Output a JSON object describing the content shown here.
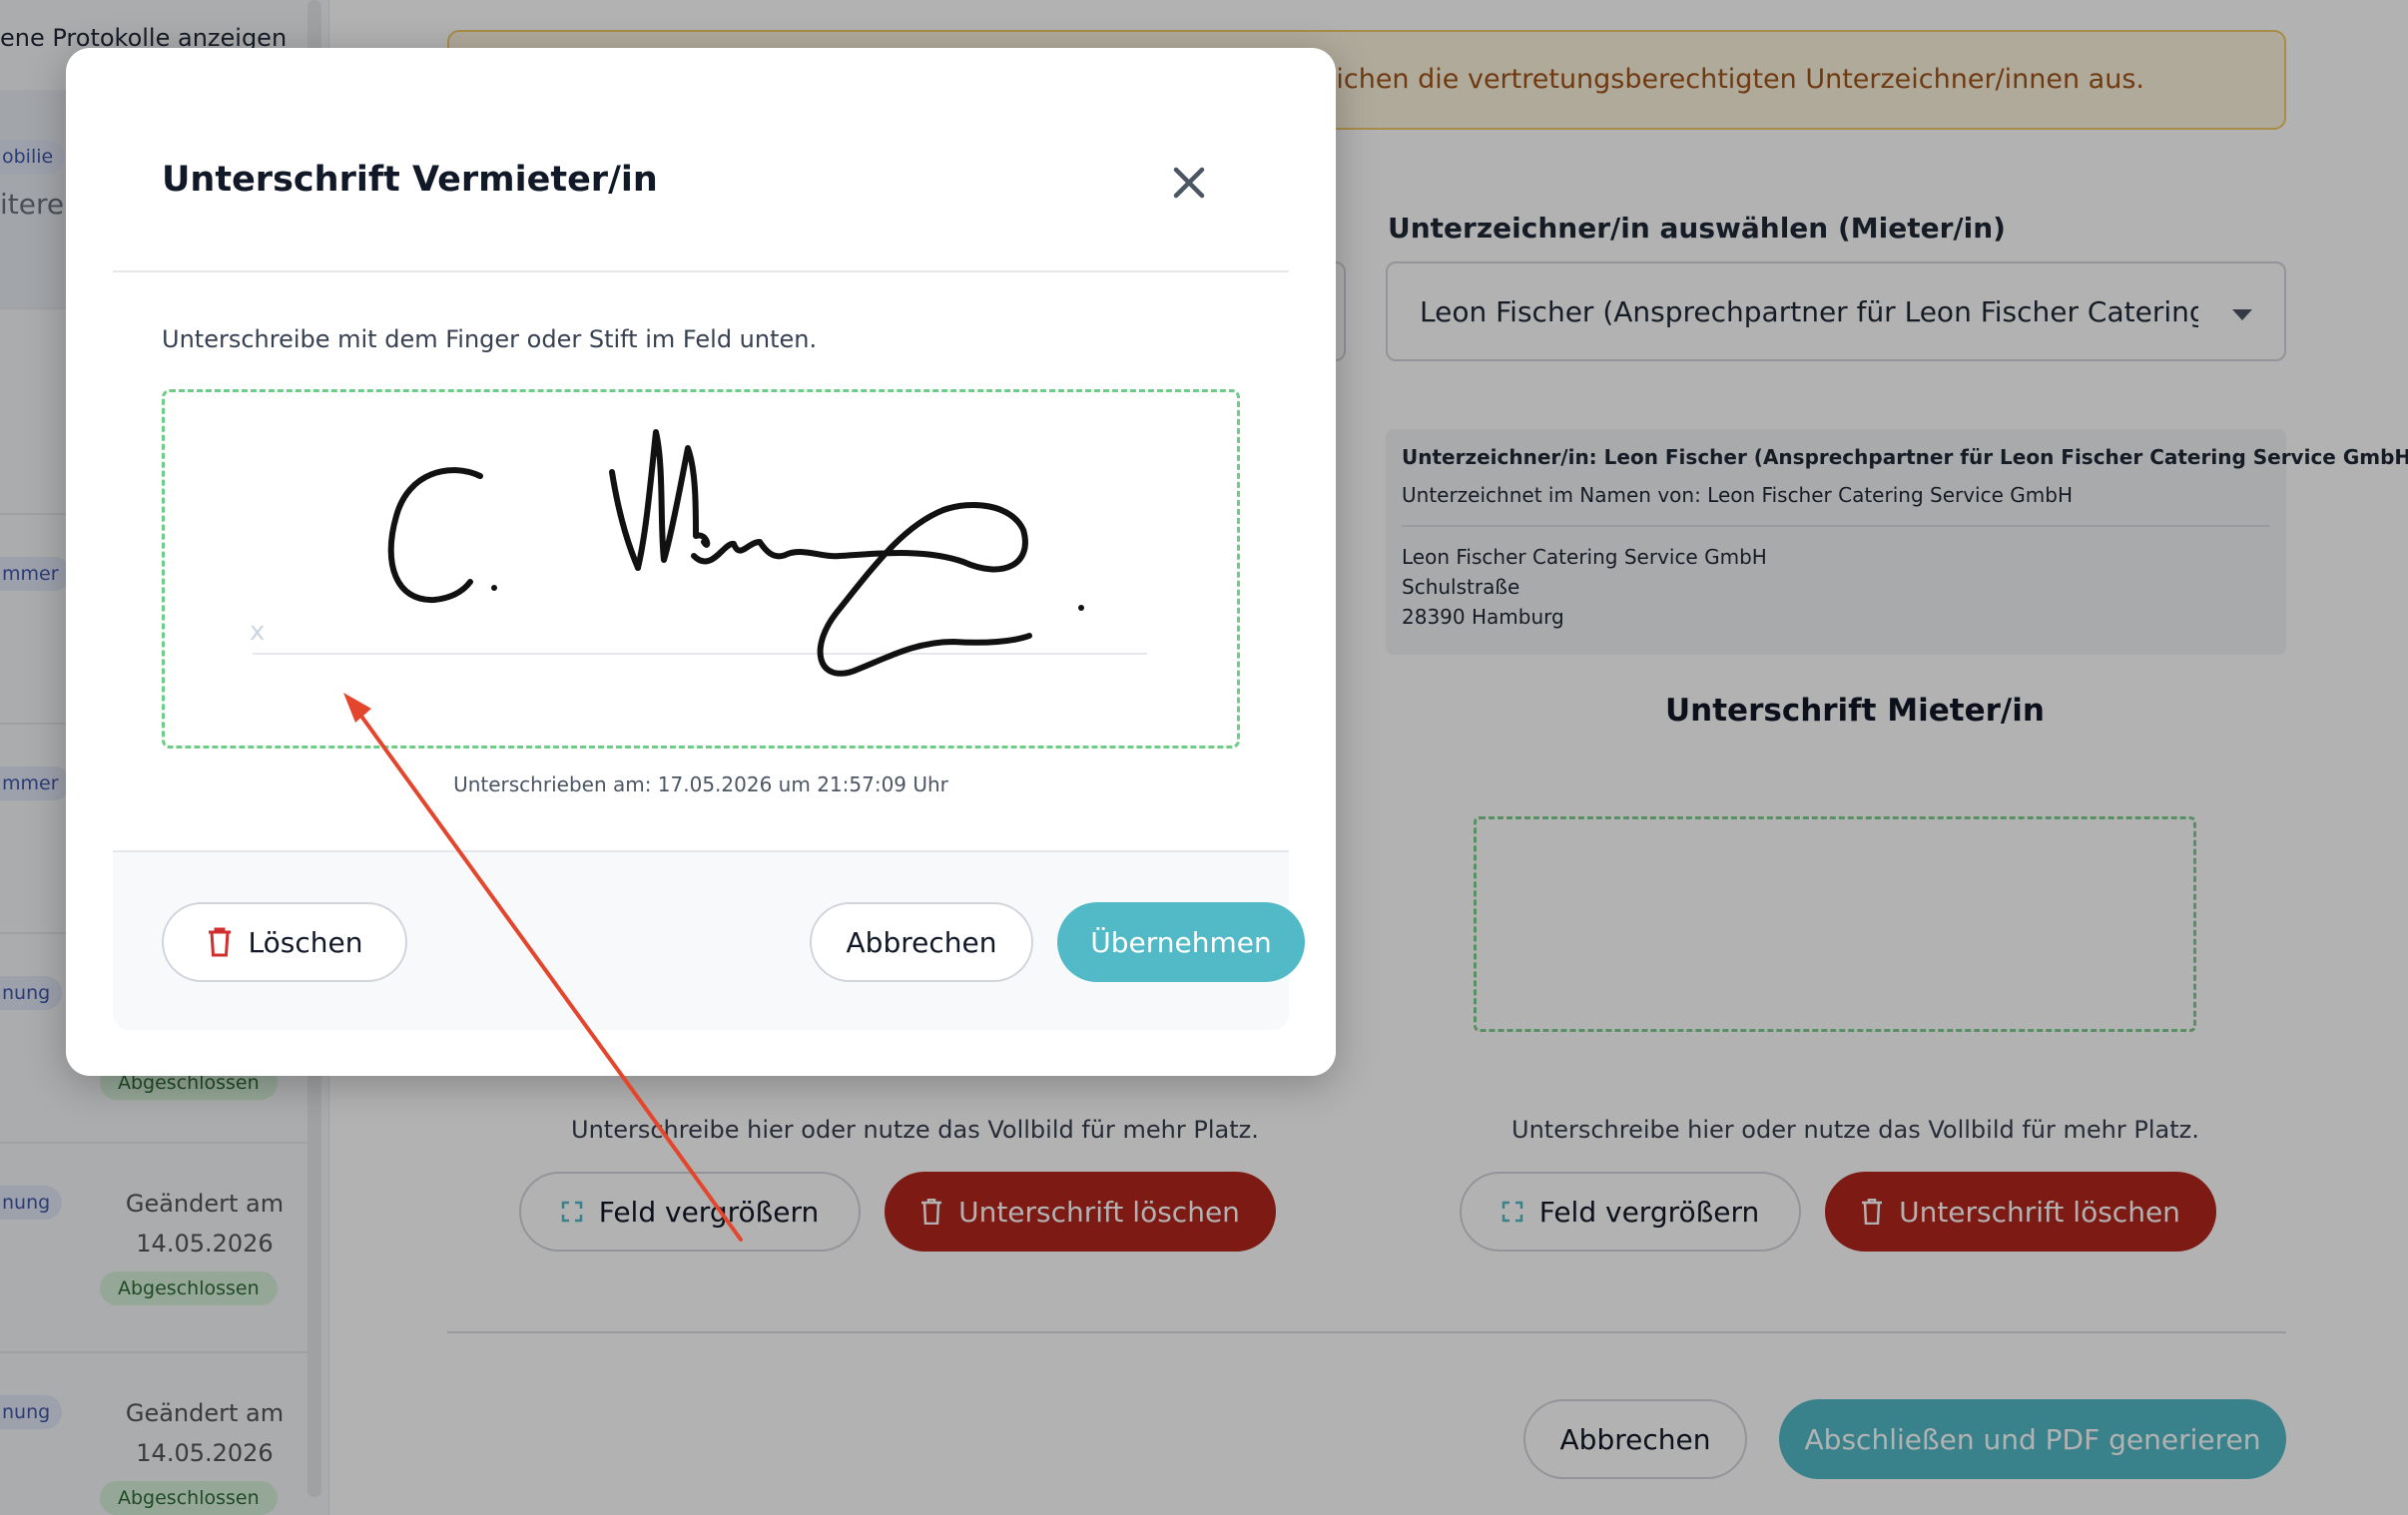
{
  "background": {
    "sidebar": {
      "top_text": "ene Protokolle anzeigen",
      "cards": [
        {
          "badge": "obilie",
          "extra": "itere"
        },
        {
          "badge": "mmer"
        },
        {
          "badge": "mmer"
        },
        {
          "badge": "nung",
          "status": "Abgeschlossen"
        },
        {
          "badge": "nung",
          "date_line1": "Geändert am",
          "date_line2": "14.05.2026",
          "status": "Abgeschlossen"
        },
        {
          "badge": "nung",
          "date_line1": "Geändert am",
          "date_line2": "14.05.2026",
          "status": "Abgeschlossen"
        }
      ]
    },
    "warning_text": "eichen die vertretungsberechtigten Unterzeichner/innen aus.",
    "tenant_select": {
      "label": "Unterzeichner/in auswählen (Mieter/in)",
      "value": "Leon Fischer (Ansprechpartner für Leon Fischer Catering S..."
    },
    "signer_info": {
      "line1": "Unterzeichner/in: Leon Fischer (Ansprechpartner für Leon Fischer Catering Service GmbH)",
      "line2": "Unterzeichnet im Namen von: Leon Fischer Catering Service GmbH",
      "company": "Leon Fischer Catering Service GmbH",
      "street": "Schulstraße",
      "city": "28390 Hamburg"
    },
    "tenant_signature_title": "Unterschrift Mieter/in",
    "hint_text": "Unterschreibe hier oder nutze das Vollbild für mehr Platz.",
    "enlarge_label": "Feld vergrößern",
    "delete_signature_label": "Unterschrift löschen",
    "cancel_label": "Abbrechen",
    "finish_label": "Abschließen und PDF generieren"
  },
  "modal": {
    "title": "Unterschrift Vermieter/in",
    "instruction": "Unterschreibe mit dem Finger oder Stift im Feld unten.",
    "pad_marker": "x",
    "timestamp": "Unterschrieben am: 17.05.2026 um 21:57:09 Uhr",
    "delete_label": "Löschen",
    "cancel_label": "Abbrechen",
    "apply_label": "Übernehmen"
  },
  "colors": {
    "primary": "#52b9c7",
    "danger": "#b3261e",
    "pad_border": "#6dcc86",
    "annotation_arrow": "#e3462d"
  }
}
